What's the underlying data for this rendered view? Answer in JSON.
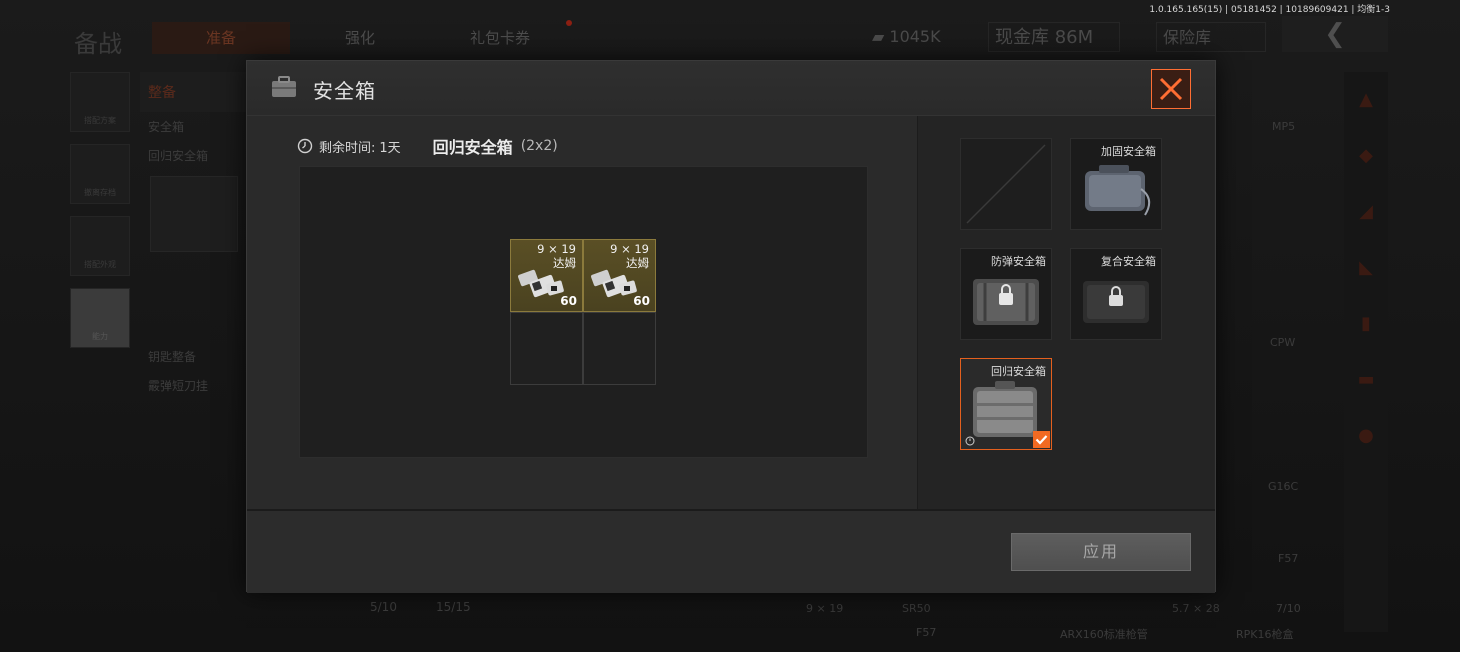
{
  "background": {
    "version": "1.0.165.165(15) | 05181452 | 10189609421 | 均衡1-3",
    "title": "备战",
    "tabs": [
      "准备",
      "强化",
      "礼包卡券"
    ],
    "money": "1045K",
    "cash_vault": "现金库 86M",
    "insurance": "保险库",
    "left_nav": [
      "搭配方案",
      "撤离存档",
      "搭配外观",
      "能力"
    ],
    "left_panel": {
      "header": "整备",
      "label": "安全箱",
      "item": "回归安全箱",
      "section": "钥匙整备",
      "item2": "霰弹短刀挂"
    },
    "counts": [
      "5/10",
      "15/15"
    ],
    "side_labels": [
      "MP5",
      "CPW",
      "G16C",
      "F57",
      "5.7 × 28",
      "7/10",
      "ARX160标准枪管",
      "RPK16枪盒",
      "9 × 19",
      "SR50",
      "F57"
    ]
  },
  "modal": {
    "title": "安全箱",
    "time_label": "剩余时间:",
    "time_value": "1天",
    "case_name": "回归安全箱",
    "case_size": "(2x2)",
    "items": [
      {
        "name_line1": "9 × 19",
        "name_line2": "达姆",
        "count": "60"
      },
      {
        "name_line1": "9 × 19",
        "name_line2": "达姆",
        "count": "60"
      }
    ],
    "slots": [
      {
        "label": ""
      },
      {
        "label": "加固安全箱"
      },
      {
        "label": "防弹安全箱"
      },
      {
        "label": "复合安全箱"
      },
      {
        "label": "回归安全箱",
        "selected": true
      }
    ],
    "apply_label": "应用",
    "accent_color": "#f26a22"
  }
}
